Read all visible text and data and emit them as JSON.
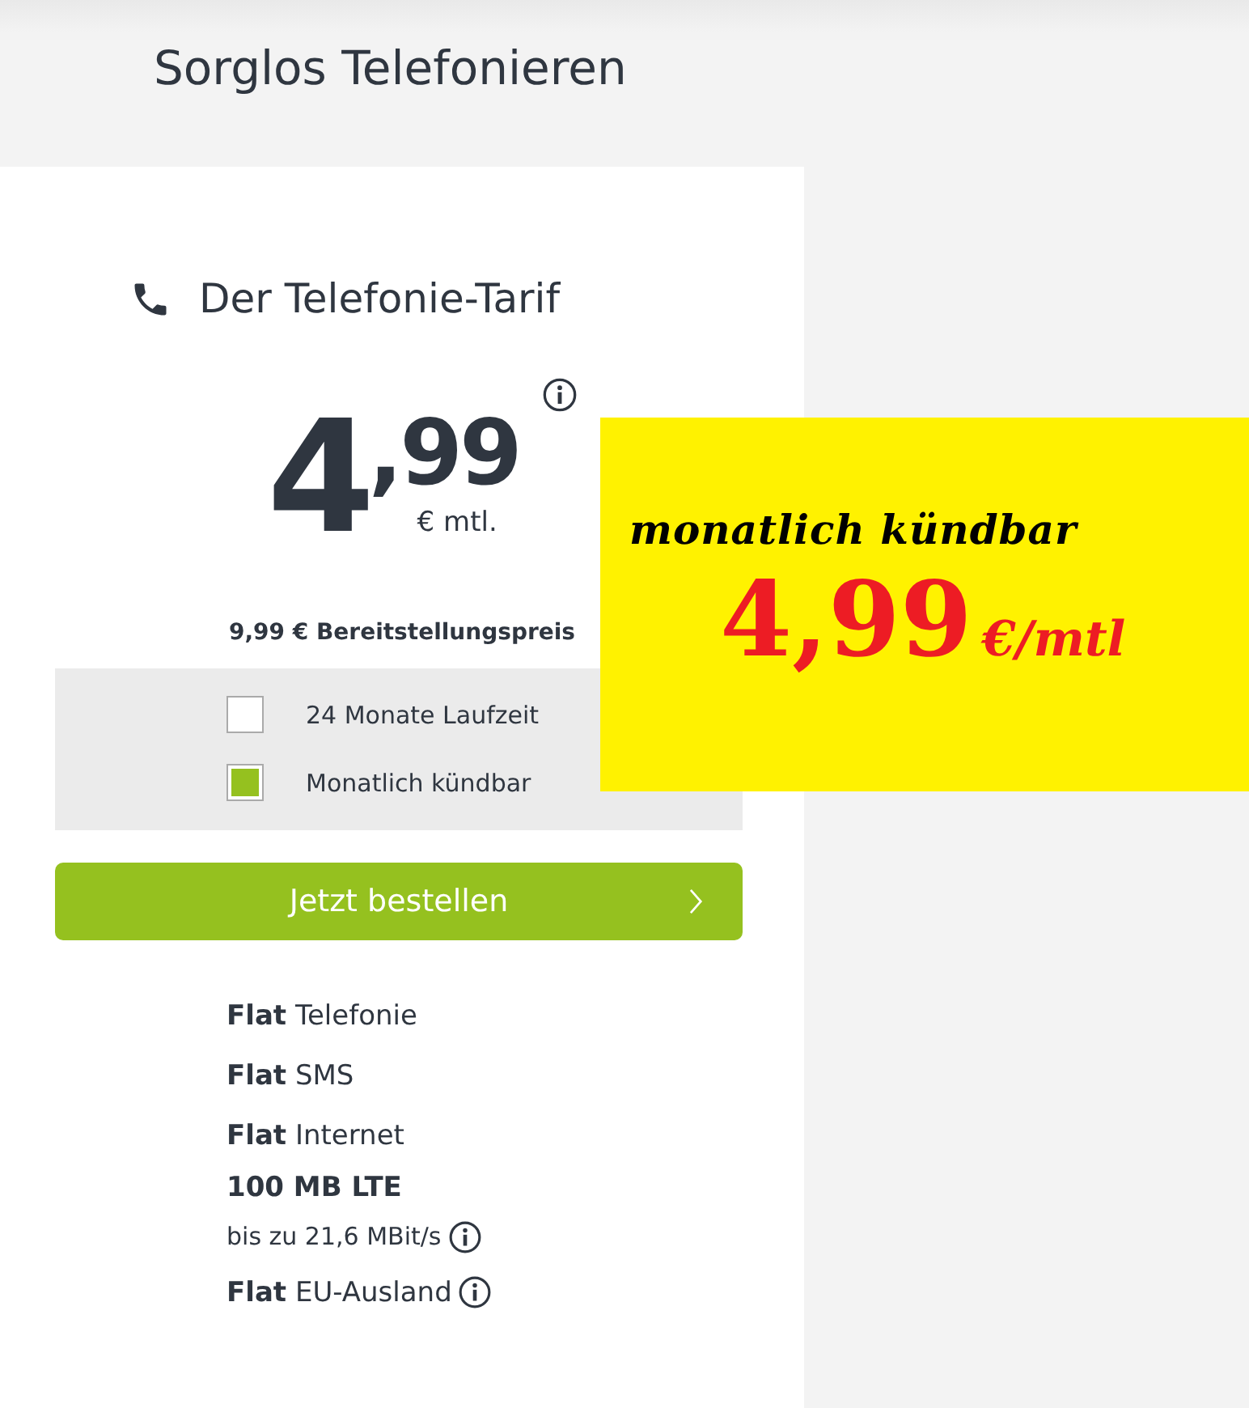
{
  "page_title": "Sorglos Telefonieren",
  "tariff": {
    "title": "Der Telefonie-Tarif",
    "price_main": "4",
    "price_cents": ",99",
    "price_unit": "€ mtl.",
    "setup_fee": "9,99 € Bereitstellungspreis"
  },
  "options": [
    {
      "label": "24 Monate Laufzeit",
      "checked": false
    },
    {
      "label": "Monatlich kündbar",
      "checked": true
    }
  ],
  "order_button": "Jetzt bestellen",
  "features": [
    {
      "text": "**Flat** Telefonie",
      "info": false
    },
    {
      "text": "**Flat** SMS",
      "info": false
    },
    {
      "text": "**Flat** Internet",
      "info": false
    },
    {
      "text": "**100 MB LTE**",
      "info": false
    },
    {
      "text": "bis zu 21,6 MBit/s",
      "info": true,
      "kind": "note"
    },
    {
      "text": "**Flat** EU-Ausland",
      "info": true
    }
  ],
  "promo": {
    "headline": "monatlich kündbar",
    "price": "4,99",
    "unit": "€/mtl"
  }
}
